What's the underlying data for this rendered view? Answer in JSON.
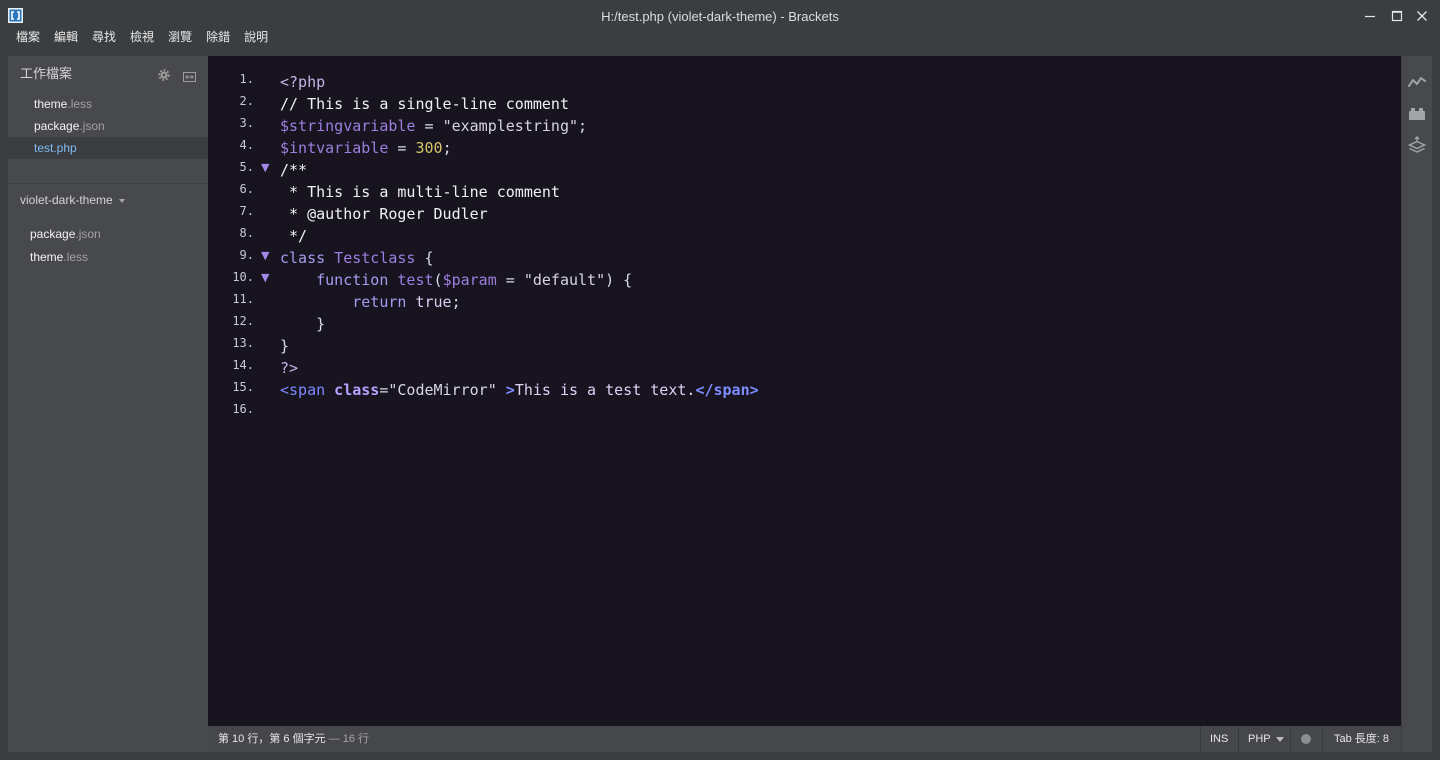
{
  "window": {
    "title": "H:/test.php (violet-dark-theme) - Brackets"
  },
  "menu": [
    "檔案",
    "編輯",
    "尋找",
    "檢視",
    "瀏覽",
    "除錯",
    "說明"
  ],
  "sidebar": {
    "working_files_title": "工作檔案",
    "working_files": [
      {
        "name": "theme",
        "ext": ".less",
        "selected": false
      },
      {
        "name": "package",
        "ext": ".json",
        "selected": false
      },
      {
        "name": "test",
        "ext": ".php",
        "selected": true
      }
    ],
    "project_title": "violet-dark-theme",
    "project_files": [
      {
        "name": "package",
        "ext": ".json"
      },
      {
        "name": "theme",
        "ext": ".less"
      }
    ]
  },
  "editor": {
    "fold_marker": "▼",
    "lines": [
      {
        "number": "1.",
        "fold": false,
        "tokens": [
          {
            "text": "<?php",
            "kind": "meta"
          }
        ]
      },
      {
        "number": "2.",
        "fold": false,
        "tokens": [
          {
            "text": "// This is a single-line comment",
            "kind": "comment"
          }
        ]
      },
      {
        "number": "3.",
        "fold": false,
        "tokens": [
          {
            "text": "$stringvariable",
            "kind": "variable"
          },
          {
            "text": " = ",
            "kind": "operator"
          },
          {
            "text": "\"examplestring\"",
            "kind": "string"
          },
          {
            "text": ";",
            "kind": "operator"
          }
        ]
      },
      {
        "number": "4.",
        "fold": false,
        "tokens": [
          {
            "text": "$intvariable",
            "kind": "variable"
          },
          {
            "text": " = ",
            "kind": "operator"
          },
          {
            "text": "300",
            "kind": "number"
          },
          {
            "text": ";",
            "kind": "operator"
          }
        ]
      },
      {
        "number": "5.",
        "fold": true,
        "tokens": [
          {
            "text": "/**",
            "kind": "comment"
          }
        ]
      },
      {
        "number": "6.",
        "fold": false,
        "tokens": [
          {
            "text": " * This is a multi-line comment",
            "kind": "comment"
          }
        ]
      },
      {
        "number": "7.",
        "fold": false,
        "tokens": [
          {
            "text": " * @author Roger Dudler",
            "kind": "comment"
          }
        ]
      },
      {
        "number": "8.",
        "fold": false,
        "tokens": [
          {
            "text": " */",
            "kind": "comment"
          }
        ]
      },
      {
        "number": "9.",
        "fold": true,
        "tokens": [
          {
            "text": "class",
            "kind": "keyword"
          },
          {
            "text": " Testclass",
            "kind": "def"
          },
          {
            "text": " {",
            "kind": "operator"
          }
        ]
      },
      {
        "number": "10.",
        "fold": true,
        "tokens": [
          {
            "text": "    function",
            "kind": "keyword"
          },
          {
            "text": " test",
            "kind": "def"
          },
          {
            "text": "(",
            "kind": "operator"
          },
          {
            "text": "$param",
            "kind": "variable"
          },
          {
            "text": " = ",
            "kind": "operator"
          },
          {
            "text": "\"default\"",
            "kind": "string"
          },
          {
            "text": ") {",
            "kind": "operator"
          }
        ]
      },
      {
        "number": "11.",
        "fold": false,
        "tokens": [
          {
            "text": "        return",
            "kind": "keyword"
          },
          {
            "text": " true",
            "kind": "atom"
          },
          {
            "text": ";",
            "kind": "operator"
          }
        ]
      },
      {
        "number": "12.",
        "fold": false,
        "tokens": [
          {
            "text": "    }",
            "kind": "operator"
          }
        ]
      },
      {
        "number": "13.",
        "fold": false,
        "tokens": [
          {
            "text": "}",
            "kind": "operator"
          }
        ]
      },
      {
        "number": "14.",
        "fold": false,
        "tokens": [
          {
            "text": "?>",
            "kind": "meta"
          }
        ]
      },
      {
        "number": "15.",
        "fold": false,
        "tokens": [
          {
            "text": "<span",
            "kind": "tag"
          },
          {
            "text": " class",
            "kind": "attribute"
          },
          {
            "text": "=",
            "kind": "operator"
          },
          {
            "text": "\"CodeMirror\"",
            "kind": "string"
          },
          {
            "text": " >",
            "kind": "tag-end"
          },
          {
            "text": "This is a test text.",
            "kind": "text"
          },
          {
            "text": "</span>",
            "kind": "tag-end"
          }
        ]
      },
      {
        "number": "16.",
        "fold": false,
        "tokens": []
      }
    ]
  },
  "statusbar": {
    "cursor_position": "第 10 行，第 6 個字元",
    "line_count": "— 16 行",
    "insert_mode": "INS",
    "language": "PHP",
    "tab_size_label": "Tab 長度:",
    "tab_size": "8"
  },
  "icons": {
    "titlebar": [
      "brackets-logo-icon",
      "minimize-icon",
      "maximize-icon",
      "close-icon"
    ],
    "sidebar": [
      "gear-icon",
      "split-view-icon",
      "caret-down-icon"
    ],
    "toolbar": [
      "live-preview-icon",
      "extension-manager-icon",
      "layers-icon"
    ],
    "statusbar": [
      "dropdown-caret-icon",
      "lint-status-icon"
    ]
  },
  "theme_colors": {
    "editor_background": "#17131f",
    "line_number": "#c9c9d7",
    "fold_marker": "#a386ec",
    "meta": "#c4b5e8",
    "comment": "#f2f0f7",
    "variable": "#9d7fe0",
    "operator": "#dcdce8",
    "string": "#d8d4e4",
    "number": "#d6c56f",
    "keyword": "#a89bef",
    "def": "#9c7ee3",
    "atom": "#d7cff0",
    "tag": "#7e8bff",
    "attribute": "#b4a3ff",
    "text": "#dcd4f6",
    "selected_file": "#7fbcf3"
  }
}
